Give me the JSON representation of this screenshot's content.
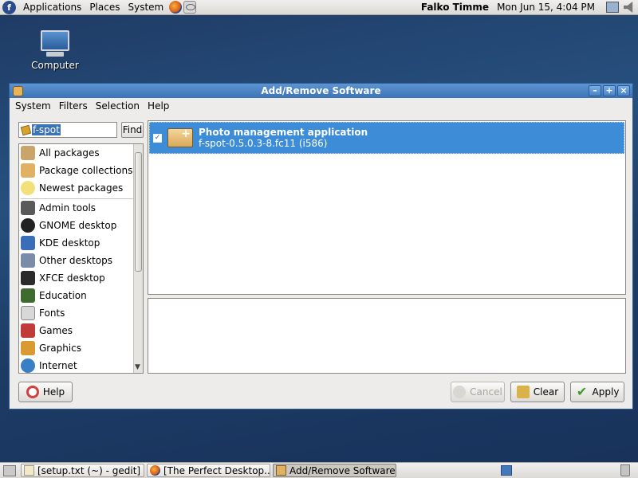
{
  "top_panel": {
    "menus": [
      "Applications",
      "Places",
      "System"
    ],
    "user": "Falko Timme",
    "clock": "Mon Jun 15,  4:04 PM"
  },
  "desktop": {
    "icons": [
      {
        "label": "Computer",
        "icon": "computer-icon"
      }
    ]
  },
  "window": {
    "title": "Add/Remove Software",
    "menu": [
      {
        "label": "System"
      },
      {
        "label": "Filters"
      },
      {
        "label": "Selection"
      },
      {
        "label": "Help"
      }
    ],
    "search": {
      "value": "f-spot",
      "find_label": "Find"
    },
    "categories": [
      {
        "label": "All packages",
        "icon": "all-packages-icon",
        "color": "#c9a46b"
      },
      {
        "label": "Package collections",
        "icon": "package-collections-icon",
        "color": "#e0b063"
      },
      {
        "label": "Newest packages",
        "icon": "lightbulb-icon",
        "color": "#f2e07a"
      },
      {
        "label": "Admin tools",
        "icon": "admin-tools-icon",
        "color": "#5a5a5a"
      },
      {
        "label": "GNOME desktop",
        "icon": "gnome-foot-icon",
        "color": "#222222"
      },
      {
        "label": "KDE desktop",
        "icon": "kde-icon",
        "color": "#3a6fb8"
      },
      {
        "label": "Other desktops",
        "icon": "other-desktops-icon",
        "color": "#7a8ca8"
      },
      {
        "label": "XFCE desktop",
        "icon": "xfce-mouse-icon",
        "color": "#2b2b2b"
      },
      {
        "label": "Education",
        "icon": "education-icon",
        "color": "#3f6b2f"
      },
      {
        "label": "Fonts",
        "icon": "fonts-icon",
        "color": "#d8d8d8"
      },
      {
        "label": "Games",
        "icon": "games-icon",
        "color": "#c23b3b"
      },
      {
        "label": "Graphics",
        "icon": "graphics-icon",
        "color": "#d99a33"
      },
      {
        "label": "Internet",
        "icon": "internet-globe-icon",
        "color": "#3a7fc4"
      }
    ],
    "packages": [
      {
        "title": "Photo management application",
        "version": "f-spot-0.5.0.3-8.fc11 (i586)",
        "checked": true,
        "selected": true
      }
    ],
    "buttons": {
      "help": "Help",
      "cancel": "Cancel",
      "clear": "Clear",
      "apply": "Apply"
    }
  },
  "taskbar": {
    "tasks": [
      {
        "label": "[setup.txt (~) - gedit]",
        "icon": "gedit-icon",
        "active": false
      },
      {
        "label": "[The Perfect Desktop...",
        "icon": "firefox-icon",
        "active": false
      },
      {
        "label": "Add/Remove Software",
        "icon": "package-icon",
        "active": true
      }
    ]
  },
  "colors": {
    "selection": "#3c8cd8",
    "titlebar": "#4a83c4"
  }
}
